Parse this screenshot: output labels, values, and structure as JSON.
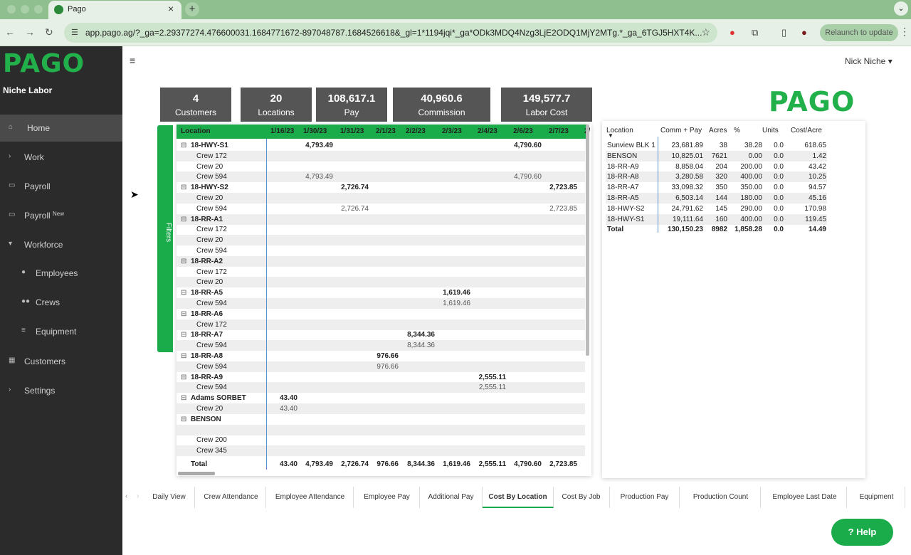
{
  "browser": {
    "tab_title": "Pago",
    "url": "app.pago.ag/?_ga=2.29377274.476600031.1684771672-897048787.1684526618&_gl=1*1194jqi*_ga*ODk3MDQ4Nzg3LjE2ODQ1MjY2MTg.*_ga_6TGJ5HXT4K...",
    "relaunch": "Relaunch to update",
    "ext_badge": "1"
  },
  "sidebar": {
    "logo": "PAGO",
    "company": "Niche Labor",
    "items": [
      {
        "label": "Home",
        "icon": "home-icon"
      },
      {
        "label": "Work",
        "icon": "chevron-right-icon"
      },
      {
        "label": "Payroll",
        "icon": "payroll-icon"
      },
      {
        "label": "Payroll",
        "sup": "New",
        "icon": "payroll-icon"
      },
      {
        "label": "Workforce",
        "icon": "chevron-down-icon"
      },
      {
        "label": "Employees",
        "icon": "person-icon"
      },
      {
        "label": "Crews",
        "icon": "group-icon"
      },
      {
        "label": "Equipment",
        "icon": "sliders-icon"
      },
      {
        "label": "Customers",
        "icon": "building-icon"
      },
      {
        "label": "Settings",
        "icon": "chevron-right-icon"
      }
    ]
  },
  "header": {
    "user": "Nick Niche"
  },
  "kpis": [
    {
      "value": "4",
      "label": "Customers"
    },
    {
      "value": "20",
      "label": "Locations"
    },
    {
      "value": "108,617.1",
      "label": "Pay"
    },
    {
      "value": "40,960.6",
      "label": "Commission"
    },
    {
      "value": "149,577.7",
      "label": "Labor Cost"
    }
  ],
  "brand_logo": "PAGO",
  "filters_label": "Filters",
  "matrix": {
    "columns": [
      "Location",
      "1/16/23",
      "1/30/23",
      "1/31/23",
      "2/1/23",
      "2/2/23",
      "2/3/23",
      "2/4/23",
      "2/6/23",
      "2/7/23",
      "2/"
    ],
    "rows": [
      {
        "label": "18-HWY-S1",
        "bold": true,
        "values": [
          "",
          "4,793.49",
          "",
          "",
          "",
          "",
          "",
          "4,790.60",
          ""
        ]
      },
      {
        "label": "Crew 172",
        "values": [
          "",
          "",
          "",
          "",
          "",
          "",
          "",
          "",
          ""
        ]
      },
      {
        "label": "Crew 20",
        "values": [
          "",
          "",
          "",
          "",
          "",
          "",
          "",
          "",
          ""
        ]
      },
      {
        "label": "Crew 594",
        "values": [
          "",
          "4,793.49",
          "",
          "",
          "",
          "",
          "",
          "4,790.60",
          ""
        ]
      },
      {
        "label": "18-HWY-S2",
        "bold": true,
        "values": [
          "",
          "",
          "2,726.74",
          "",
          "",
          "",
          "",
          "",
          "2,723.85"
        ]
      },
      {
        "label": "Crew 20",
        "values": [
          "",
          "",
          "",
          "",
          "",
          "",
          "",
          "",
          ""
        ]
      },
      {
        "label": "Crew 594",
        "values": [
          "",
          "",
          "2,726.74",
          "",
          "",
          "",
          "",
          "",
          "2,723.85"
        ]
      },
      {
        "label": "18-RR-A1",
        "bold": true,
        "values": [
          "",
          "",
          "",
          "",
          "",
          "",
          "",
          "",
          ""
        ]
      },
      {
        "label": "Crew 172",
        "values": [
          "",
          "",
          "",
          "",
          "",
          "",
          "",
          "",
          ""
        ]
      },
      {
        "label": "Crew 20",
        "values": [
          "",
          "",
          "",
          "",
          "",
          "",
          "",
          "",
          ""
        ]
      },
      {
        "label": "Crew 594",
        "values": [
          "",
          "",
          "",
          "",
          "",
          "",
          "",
          "",
          ""
        ]
      },
      {
        "label": "18-RR-A2",
        "bold": true,
        "values": [
          "",
          "",
          "",
          "",
          "",
          "",
          "",
          "",
          ""
        ]
      },
      {
        "label": "Crew 172",
        "values": [
          "",
          "",
          "",
          "",
          "",
          "",
          "",
          "",
          ""
        ]
      },
      {
        "label": "Crew 20",
        "values": [
          "",
          "",
          "",
          "",
          "",
          "",
          "",
          "",
          ""
        ]
      },
      {
        "label": "18-RR-A5",
        "bold": true,
        "values": [
          "",
          "",
          "",
          "",
          "",
          "1,619.46",
          "",
          "",
          ""
        ]
      },
      {
        "label": "Crew 594",
        "values": [
          "",
          "",
          "",
          "",
          "",
          "1,619.46",
          "",
          "",
          ""
        ]
      },
      {
        "label": "18-RR-A6",
        "bold": true,
        "values": [
          "",
          "",
          "",
          "",
          "",
          "",
          "",
          "",
          ""
        ]
      },
      {
        "label": "Crew 172",
        "values": [
          "",
          "",
          "",
          "",
          "",
          "",
          "",
          "",
          ""
        ]
      },
      {
        "label": "18-RR-A7",
        "bold": true,
        "values": [
          "",
          "",
          "",
          "",
          "8,344.36",
          "",
          "",
          "",
          ""
        ]
      },
      {
        "label": "Crew 594",
        "values": [
          "",
          "",
          "",
          "",
          "8,344.36",
          "",
          "",
          "",
          ""
        ]
      },
      {
        "label": "18-RR-A8",
        "bold": true,
        "values": [
          "",
          "",
          "",
          "976.66",
          "",
          "",
          "",
          "",
          ""
        ]
      },
      {
        "label": "Crew 594",
        "values": [
          "",
          "",
          "",
          "976.66",
          "",
          "",
          "",
          "",
          ""
        ]
      },
      {
        "label": "18-RR-A9",
        "bold": true,
        "values": [
          "",
          "",
          "",
          "",
          "",
          "",
          "2,555.11",
          "",
          ""
        ]
      },
      {
        "label": "Crew 594",
        "values": [
          "",
          "",
          "",
          "",
          "",
          "",
          "2,555.11",
          "",
          ""
        ]
      },
      {
        "label": "Adams SORBET",
        "bold": true,
        "values": [
          "43.40",
          "",
          "",
          "",
          "",
          "",
          "",
          "",
          ""
        ]
      },
      {
        "label": "Crew 20",
        "values": [
          "43.40",
          "",
          "",
          "",
          "",
          "",
          "",
          "",
          ""
        ]
      },
      {
        "label": "BENSON",
        "bold": true,
        "values": [
          "",
          "",
          "",
          "",
          "",
          "",
          "",
          "",
          ""
        ]
      },
      {
        "label": "",
        "values": [
          "",
          "",
          "",
          "",
          "",
          "",
          "",
          "",
          ""
        ]
      },
      {
        "label": "Crew 200",
        "values": [
          "",
          "",
          "",
          "",
          "",
          "",
          "",
          "",
          ""
        ]
      },
      {
        "label": "Crew 345",
        "values": [
          "",
          "",
          "",
          "",
          "",
          "",
          "",
          "",
          ""
        ]
      }
    ],
    "total": {
      "label": "Total",
      "values": [
        "43.40",
        "4,793.49",
        "2,726.74",
        "976.66",
        "8,344.36",
        "1,619.46",
        "2,555.11",
        "4,790.60",
        "2,723.85"
      ]
    }
  },
  "summary": {
    "columns": [
      "Location",
      "Comm + Pay",
      "Acres",
      "%",
      "Units",
      "Cost/Acre"
    ],
    "rows": [
      [
        "Sunview BLK 1",
        "23,681.89",
        "38",
        "38.28",
        "0.0",
        "618.65"
      ],
      [
        "BENSON",
        "10,825.01",
        "7621",
        "0.00",
        "0.0",
        "1.42"
      ],
      [
        "18-RR-A9",
        "8,858.04",
        "204",
        "200.00",
        "0.0",
        "43.42"
      ],
      [
        "18-RR-A8",
        "3,280.58",
        "320",
        "400.00",
        "0.0",
        "10.25"
      ],
      [
        "18-RR-A7",
        "33,098.32",
        "350",
        "350.00",
        "0.0",
        "94.57"
      ],
      [
        "18-RR-A5",
        "6,503.14",
        "144",
        "180.00",
        "0.0",
        "45.16"
      ],
      [
        "18-HWY-S2",
        "24,791.62",
        "145",
        "290.00",
        "0.0",
        "170.98"
      ],
      [
        "18-HWY-S1",
        "19,111.64",
        "160",
        "400.00",
        "0.0",
        "119.45"
      ]
    ],
    "total": [
      "Total",
      "130,150.23",
      "8982",
      "1,858.28",
      "0.0",
      "14.49"
    ]
  },
  "report_tabs": [
    "Daily View",
    "Crew Attendance",
    "Employee Attendance",
    "Employee Pay",
    "Additional Pay",
    "Cost By Location",
    "Cost By Job",
    "Production Pay",
    "Production Count",
    "Employee Last Date",
    "Equipment"
  ],
  "active_tab": "Cost By Location",
  "help": "Help"
}
